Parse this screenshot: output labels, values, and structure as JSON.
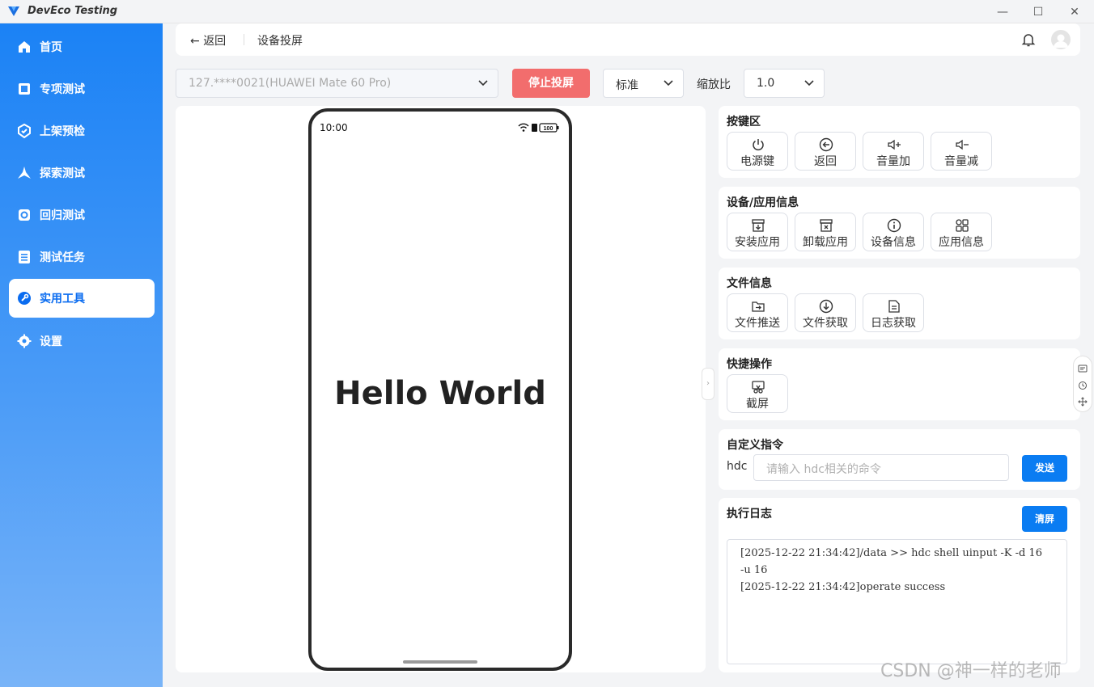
{
  "window": {
    "title": "DevEco Testing",
    "controls": [
      "minimize-icon",
      "maximize-icon",
      "close-icon"
    ]
  },
  "sidebar": {
    "items": [
      {
        "label": "首页",
        "icon": "home-icon"
      },
      {
        "label": "专项测试",
        "icon": "square-icon"
      },
      {
        "label": "上架预检",
        "icon": "shield-check-icon"
      },
      {
        "label": "探索测试",
        "icon": "compass-icon"
      },
      {
        "label": "回归测试",
        "icon": "regression-icon"
      },
      {
        "label": "测试任务",
        "icon": "list-icon"
      },
      {
        "label": "实用工具",
        "icon": "wrench-icon",
        "active": true
      },
      {
        "label": "设置",
        "icon": "gear-icon"
      }
    ]
  },
  "header": {
    "back_label": "返回",
    "page_title": "设备投屏"
  },
  "toolbar": {
    "device": "127.****0021(HUAWEI Mate 60 Pro)",
    "stop_label": "停止投屏",
    "quality": "标准",
    "zoom_label": "缩放比",
    "zoom": "1.0"
  },
  "phone": {
    "time": "10:00",
    "battery": "100",
    "content": "Hello World"
  },
  "keys": {
    "title": "按键区",
    "buttons": [
      "电源键",
      "返回",
      "音量加",
      "音量减"
    ]
  },
  "device_info": {
    "title": "设备/应用信息",
    "buttons": [
      "安装应用",
      "卸载应用",
      "设备信息",
      "应用信息"
    ]
  },
  "file_info": {
    "title": "文件信息",
    "buttons": [
      "文件推送",
      "文件获取",
      "日志获取"
    ]
  },
  "shortcuts": {
    "title": "快捷操作",
    "buttons": [
      "截屏"
    ]
  },
  "custom_cmd": {
    "title": "自定义指令",
    "prefix": "hdc",
    "placeholder": "请输入 hdc相关的命令",
    "send_label": "发送"
  },
  "exec_log": {
    "title": "执行日志",
    "clear_label": "清屏",
    "lines": [
      "[2025-12-22 21:34:42]/data >> hdc shell uinput -K -d 16",
      "-u 16",
      "[2025-12-22 21:34:42]operate success"
    ]
  },
  "watermark": "CSDN @神一样的老师",
  "colors": {
    "accent": "#0a7cf2",
    "stop": "#f26d6d",
    "sidebar_top": "#1b82f5",
    "sidebar_bottom": "#79b4f8"
  }
}
